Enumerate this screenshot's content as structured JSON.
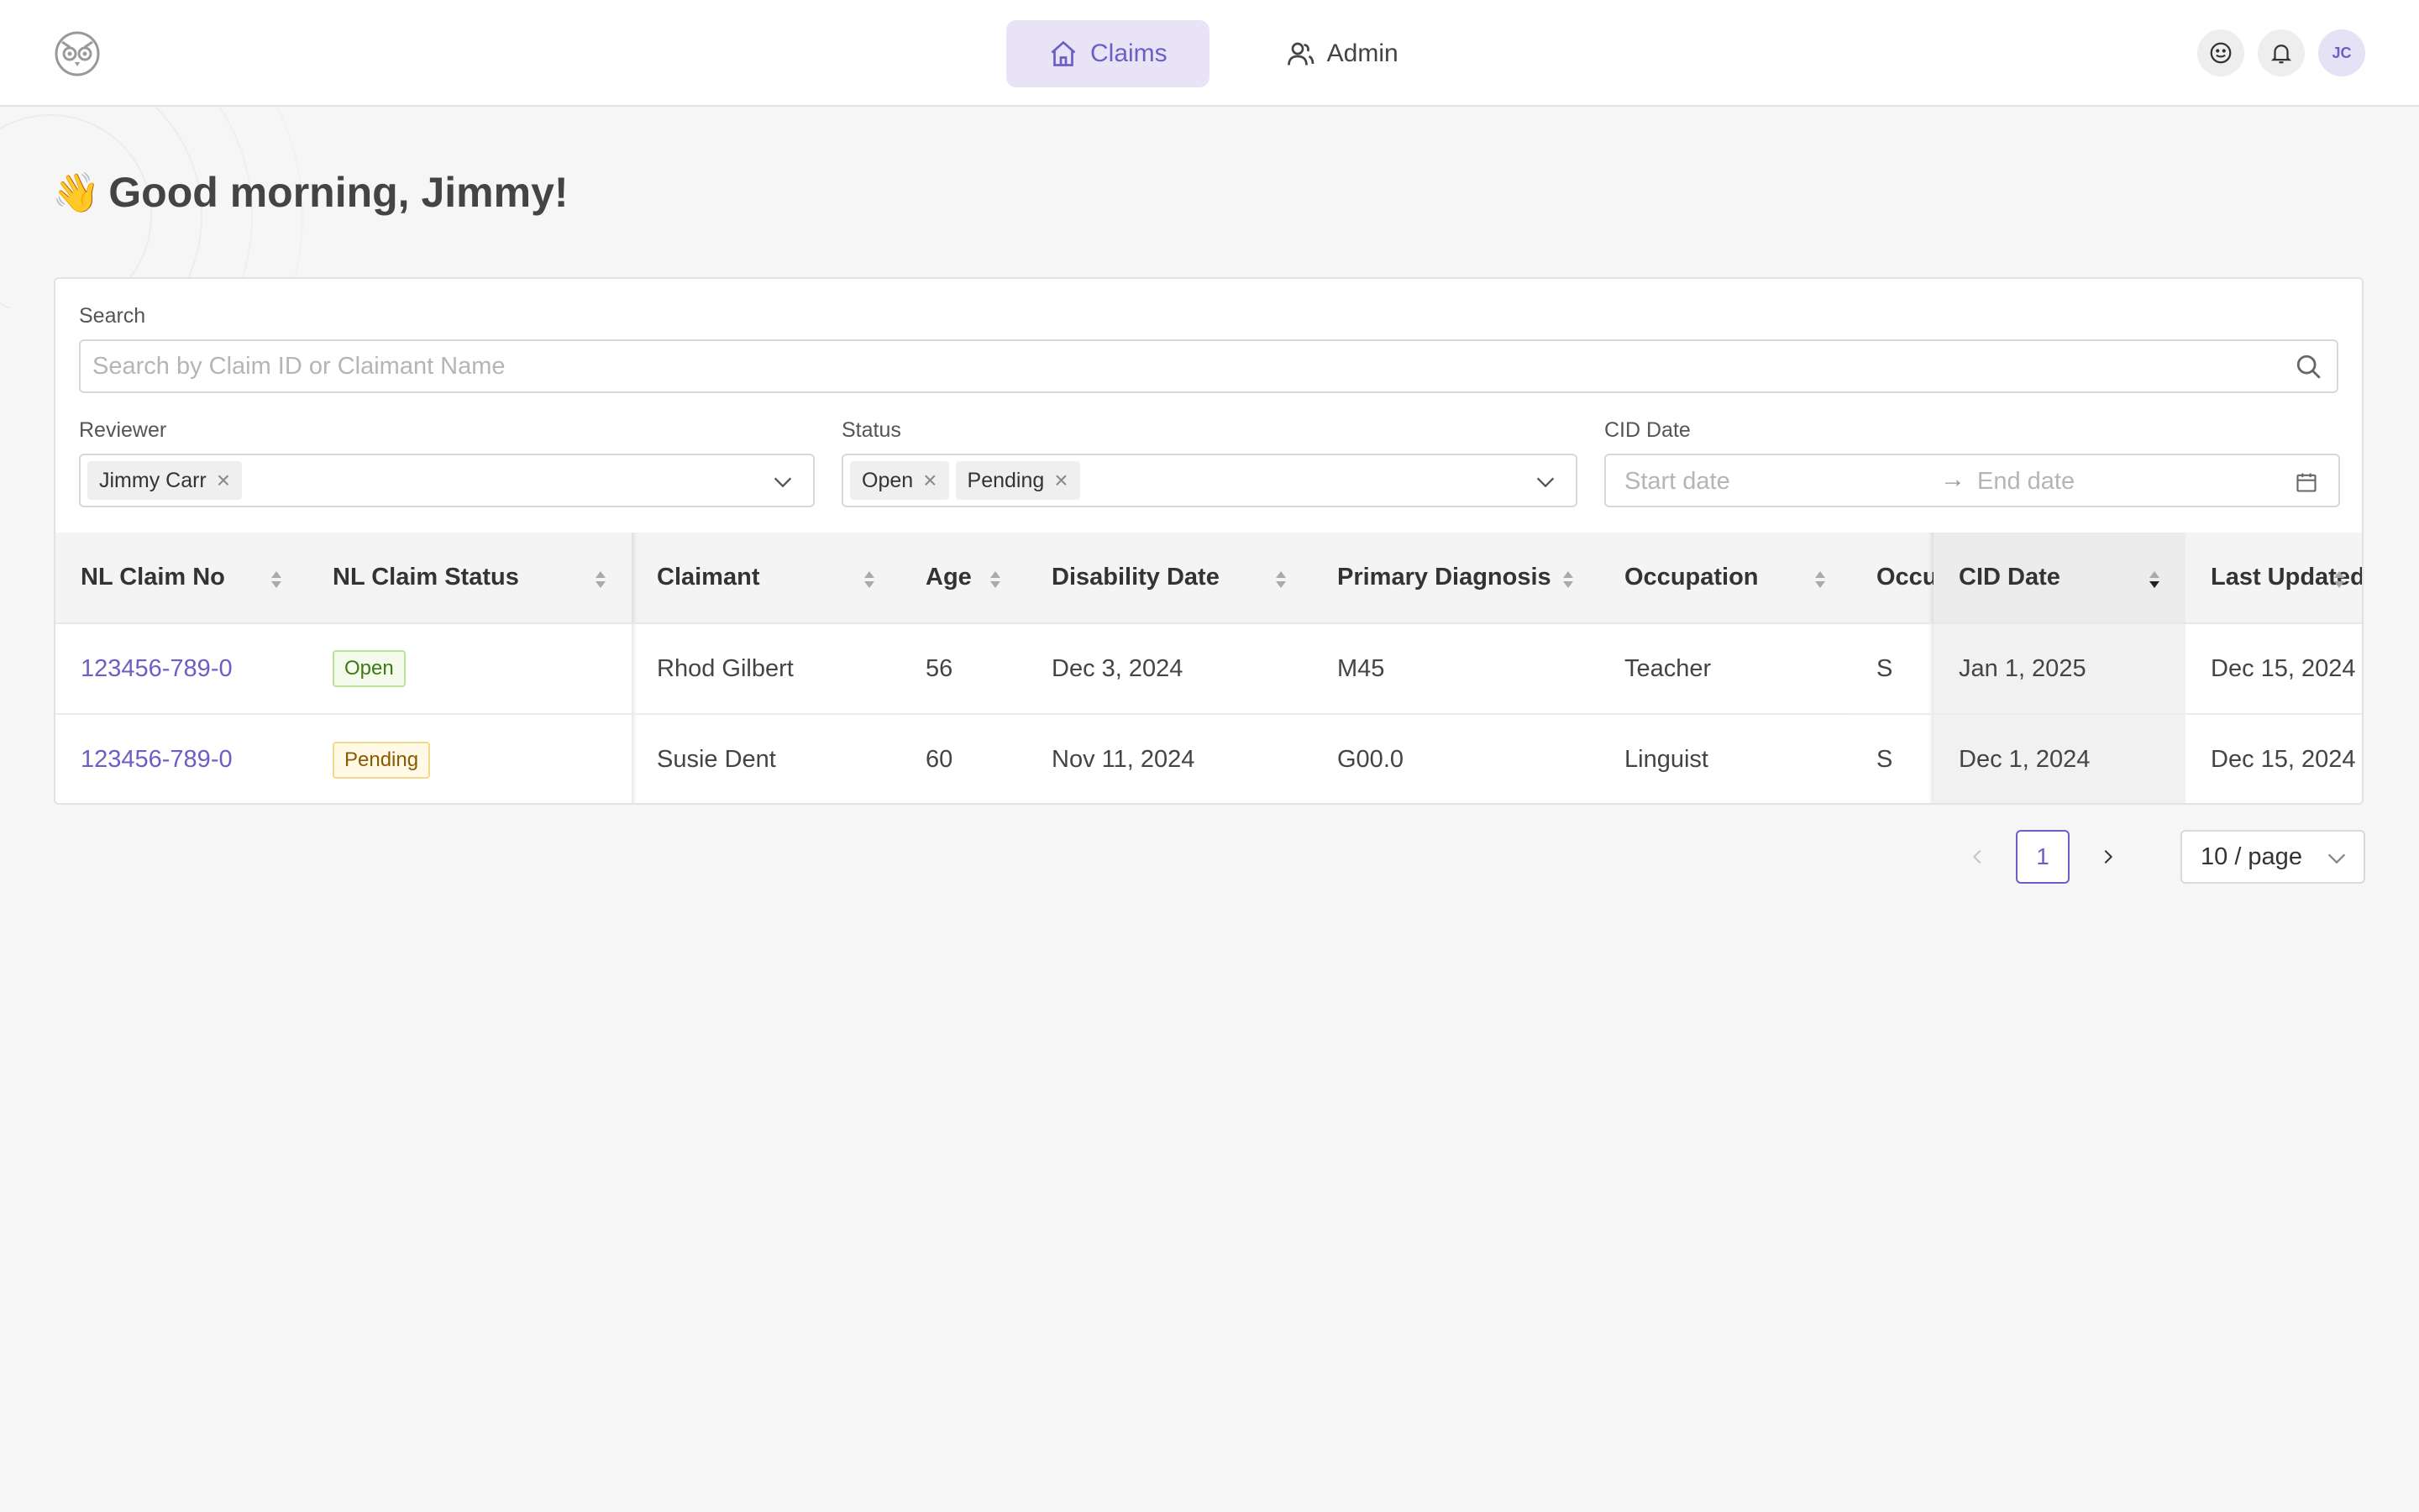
{
  "nav": {
    "items": [
      {
        "label": "Claims",
        "icon": "home-icon",
        "active": true
      },
      {
        "label": "Admin",
        "icon": "users-icon",
        "active": false
      }
    ]
  },
  "user": {
    "initials": "JC"
  },
  "greeting": {
    "emoji": "👋",
    "text": "Good morning, Jimmy!"
  },
  "filters": {
    "search_label": "Search",
    "search_placeholder": "Search by Claim ID or Claimant Name",
    "reviewer_label": "Reviewer",
    "reviewer_tags": [
      "Jimmy Carr"
    ],
    "status_label": "Status",
    "status_tags": [
      "Open",
      "Pending"
    ],
    "cid_label": "CID Date",
    "start_placeholder": "Start date",
    "end_placeholder": "End date"
  },
  "table": {
    "columns": [
      "NL Claim No",
      "NL Claim Status",
      "Claimant",
      "Age",
      "Disability Date",
      "Primary Diagnosis",
      "Occupation",
      "Occu",
      "CID Date",
      "Last Updated"
    ],
    "rows": [
      {
        "claim_no": "123456-789-0",
        "status": "Open",
        "claimant": "Rhod Gilbert",
        "age": "56",
        "disability_date": "Dec 3, 2024",
        "diagnosis": "M45",
        "occupation": "Teacher",
        "occu": "S",
        "cid_date": "Jan 1, 2025",
        "last_updated": "Dec 15, 2024"
      },
      {
        "claim_no": "123456-789-0",
        "status": "Pending",
        "claimant": "Susie Dent",
        "age": "60",
        "disability_date": "Nov 11, 2024",
        "diagnosis": "G00.0",
        "occupation": "Linguist",
        "occu": "S",
        "cid_date": "Dec 1, 2024",
        "last_updated": "Dec 15, 2024"
      }
    ]
  },
  "pagination": {
    "current_page": "1",
    "page_size": "10 / page"
  },
  "colors": {
    "accent": "#6b5fc7",
    "open": "#3d7a12",
    "pending": "#8a5a00"
  }
}
